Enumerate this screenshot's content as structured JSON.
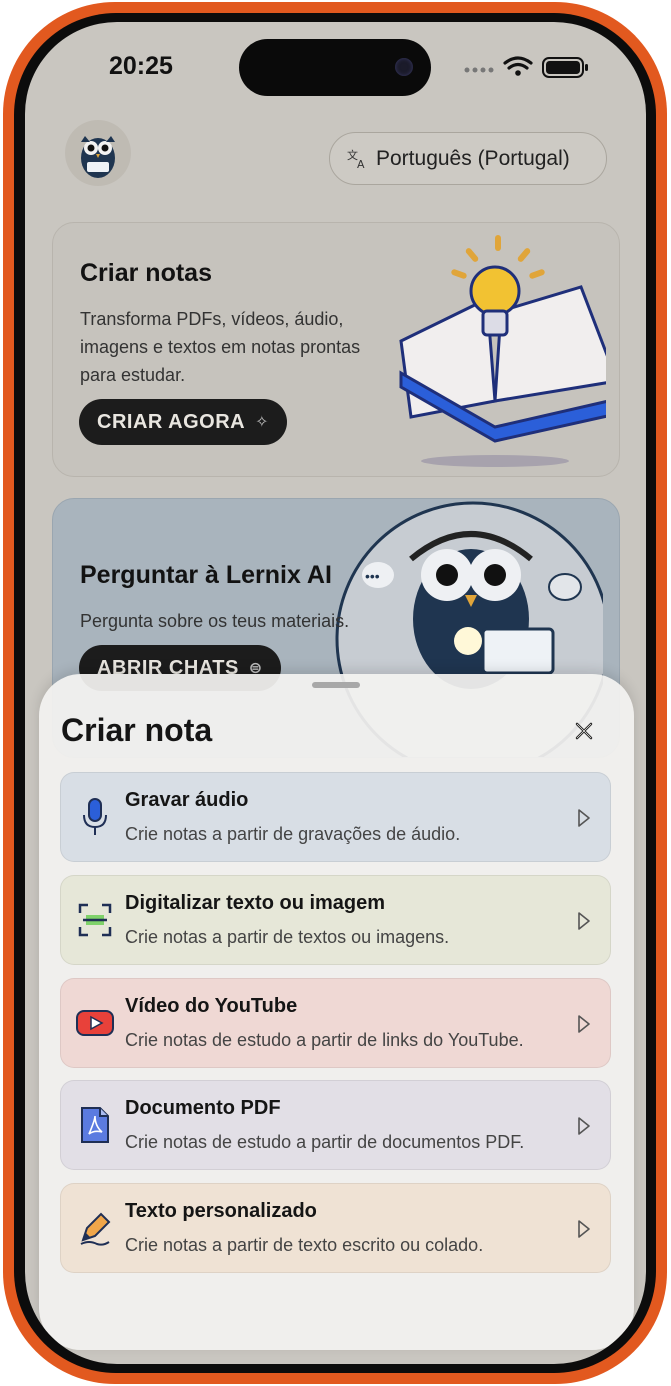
{
  "status_bar": {
    "time": "20:25"
  },
  "header": {
    "language": "Português (Portugal)"
  },
  "cards": [
    {
      "title": "Criar notas",
      "description": "Transforma PDFs, vídeos, áudio, imagens e textos em notas prontas para estudar.",
      "button": "CRIAR AGORA"
    },
    {
      "title": "Perguntar à Lernix AI",
      "description": "Pergunta sobre os teus materiais.",
      "button": "ABRIR CHATS"
    }
  ],
  "sheet": {
    "title": "Criar nota",
    "options": [
      {
        "title": "Gravar áudio",
        "description": "Crie notas a partir de gravações de áudio.",
        "icon": "microphone-icon",
        "bg": "#d8dee5"
      },
      {
        "title": "Digitalizar texto ou imagem",
        "description": "Crie notas a partir de textos ou imagens.",
        "icon": "scan-icon",
        "bg": "#e6e7d8"
      },
      {
        "title": "Vídeo do YouTube",
        "description": "Crie notas de estudo a partir de links do YouTube.",
        "icon": "youtube-icon",
        "bg": "#efd8d4"
      },
      {
        "title": "Documento PDF",
        "description": "Crie notas de estudo a partir de documentos PDF.",
        "icon": "pdf-icon",
        "bg": "#e2dfe6"
      },
      {
        "title": "Texto personalizado",
        "description": "Crie notas a partir de texto escrito ou colado.",
        "icon": "pen-icon",
        "bg": "#efe2d4"
      }
    ]
  },
  "colors": {
    "frame": "#e2591f",
    "accent": "#2b5fd9",
    "dark_button": "#1c1c1c"
  }
}
